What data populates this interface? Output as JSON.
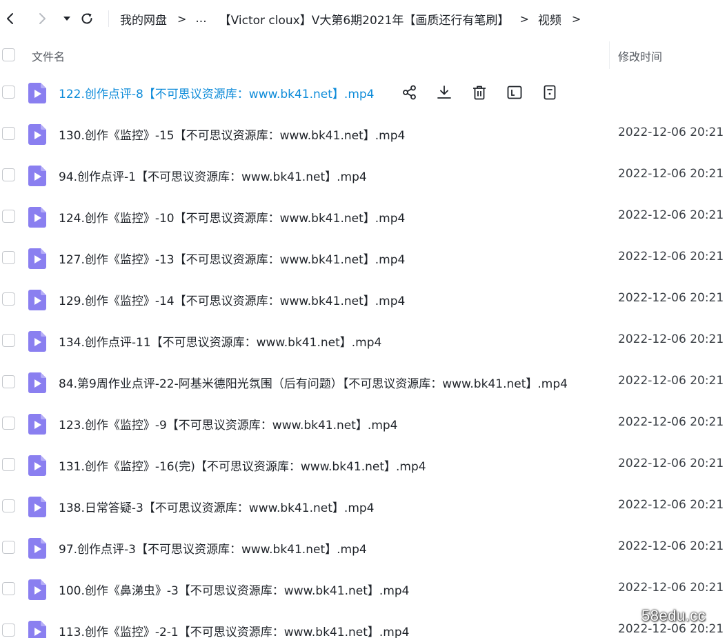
{
  "nav": {
    "icons": [
      "back-arrow-icon",
      "forward-arrow-icon",
      "dropdown-caret-icon",
      "refresh-icon"
    ],
    "breadcrumb": {
      "root": "我的网盘",
      "ellipsis": "...",
      "folder": "【Victor cloux】V大第6期2021年【画质还行有笔刷】",
      "current": "视频",
      "separator": ">"
    }
  },
  "header": {
    "name_col": "文件名",
    "time_col": "修改时间"
  },
  "row_actions": {
    "icons": [
      "share-icon",
      "download-icon",
      "delete-icon",
      "terminal-icon",
      "more-icon"
    ]
  },
  "colors": {
    "accent": "#0d8bd9",
    "file_icon": "#8a7ff0",
    "text": "#1f2329",
    "muted": "#555a61"
  },
  "files": [
    {
      "name": "122.创作点评-8【不可思议资源库：www.bk41.net】.mp4",
      "time": ""
    },
    {
      "name": "130.创作《监控》-15【不可思议资源库：www.bk41.net】.mp4",
      "time": "2022-12-06 20:21"
    },
    {
      "name": "94.创作点评-1【不可思议资源库：www.bk41.net】.mp4",
      "time": "2022-12-06 20:21"
    },
    {
      "name": "124.创作《监控》-10【不可思议资源库：www.bk41.net】.mp4",
      "time": "2022-12-06 20:21"
    },
    {
      "name": "127.创作《监控》-13【不可思议资源库：www.bk41.net】.mp4",
      "time": "2022-12-06 20:21"
    },
    {
      "name": "129.创作《监控》-14【不可思议资源库：www.bk41.net】.mp4",
      "time": "2022-12-06 20:21"
    },
    {
      "name": "134.创作点评-11【不可思议资源库：www.bk41.net】.mp4",
      "time": "2022-12-06 20:21"
    },
    {
      "name": "84.第9周作业点评-22-阿基米德阳光氛围（后有问题）【不可思议资源库：www.bk41.net】.mp4",
      "time": "2022-12-06 20:21"
    },
    {
      "name": "123.创作《监控》-9【不可思议资源库：www.bk41.net】.mp4",
      "time": "2022-12-06 20:21"
    },
    {
      "name": "131.创作《监控》-16(完)【不可思议资源库：www.bk41.net】.mp4",
      "time": "2022-12-06 20:21"
    },
    {
      "name": "138.日常答疑-3【不可思议资源库：www.bk41.net】.mp4",
      "time": "2022-12-06 20:21"
    },
    {
      "name": "97.创作点评-3【不可思议资源库：www.bk41.net】.mp4",
      "time": "2022-12-06 20:21"
    },
    {
      "name": "100.创作《鼻涕虫》-3【不可思议资源库：www.bk41.net】.mp4",
      "time": "2022-12-06 20:21"
    },
    {
      "name": "113.创作《监控》-2-1【不可思议资源库：www.bk41.net】.mp4",
      "time": "2022-12-06 20:21"
    }
  ],
  "watermark": "58edu.cc"
}
